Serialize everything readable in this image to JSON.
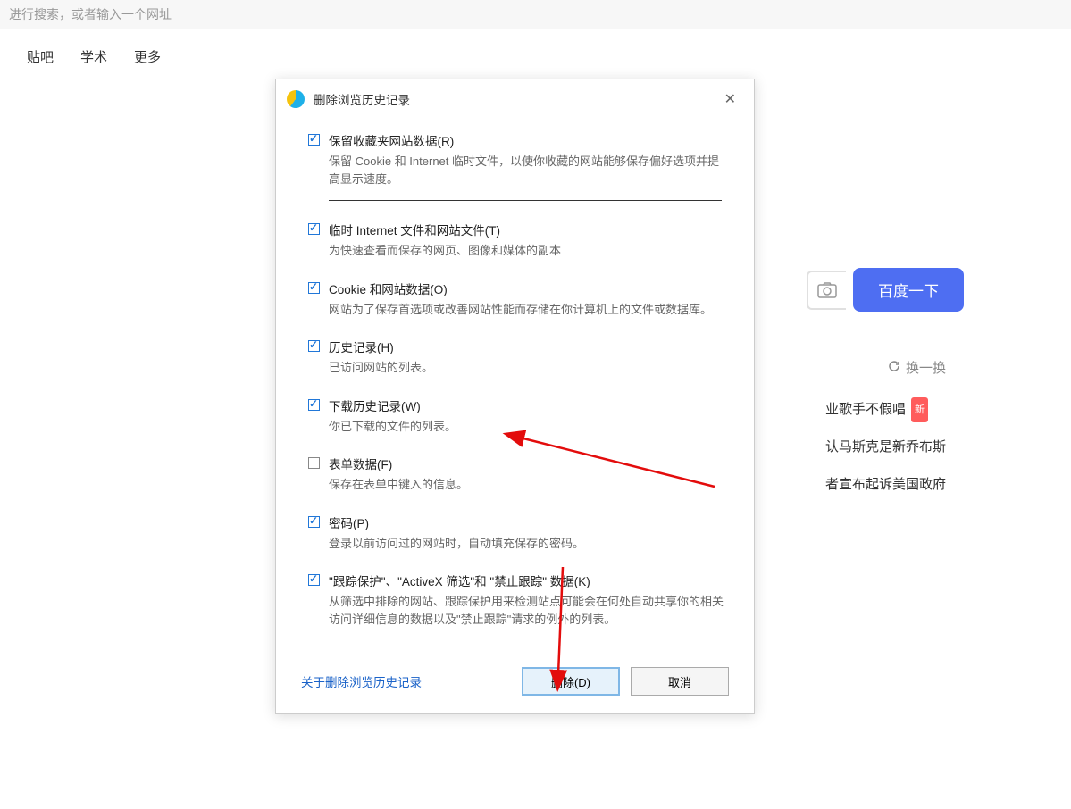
{
  "addressBar": {
    "placeholder": "进行搜索，或者输入一个网址"
  },
  "nav": {
    "tieba": "贴吧",
    "xueshu": "学术",
    "more": "更多"
  },
  "search": {
    "button": "百度一下"
  },
  "side": {
    "refresh": "换一换",
    "items": [
      {
        "text": "业歌手不假唱",
        "badge": "新"
      },
      {
        "text": "认马斯克是新乔布斯",
        "badge": ""
      },
      {
        "text": "者宣布起诉美国政府",
        "badge": ""
      }
    ]
  },
  "dialog": {
    "title": "删除浏览历史记录",
    "options": [
      {
        "checked": true,
        "label": "保留收藏夹网站数据(R)",
        "desc": "保留 Cookie 和 Internet 临时文件，以使你收藏的网站能够保存偏好选项并提高显示速度。",
        "divider": true
      },
      {
        "checked": true,
        "label": "临时 Internet 文件和网站文件(T)",
        "desc": "为快速查看而保存的网页、图像和媒体的副本"
      },
      {
        "checked": true,
        "label": "Cookie 和网站数据(O)",
        "desc": "网站为了保存首选项或改善网站性能而存储在你计算机上的文件或数据库。"
      },
      {
        "checked": true,
        "label": "历史记录(H)",
        "desc": "已访问网站的列表。"
      },
      {
        "checked": true,
        "label": "下载历史记录(W)",
        "desc": "你已下载的文件的列表。"
      },
      {
        "checked": false,
        "label": "表单数据(F)",
        "desc": "保存在表单中键入的信息。"
      },
      {
        "checked": true,
        "label": "密码(P)",
        "desc": "登录以前访问过的网站时，自动填充保存的密码。"
      },
      {
        "checked": true,
        "label": "\"跟踪保护\"、\"ActiveX 筛选\"和 \"禁止跟踪\" 数据(K)",
        "desc": "从筛选中排除的网站、跟踪保护用来检测站点可能会在何处自动共享你的相关访问详细信息的数据以及\"禁止跟踪\"请求的例外的列表。"
      }
    ],
    "footerLink": "关于删除浏览历史记录",
    "deleteBtn": "删除(D)",
    "cancelBtn": "取消"
  }
}
